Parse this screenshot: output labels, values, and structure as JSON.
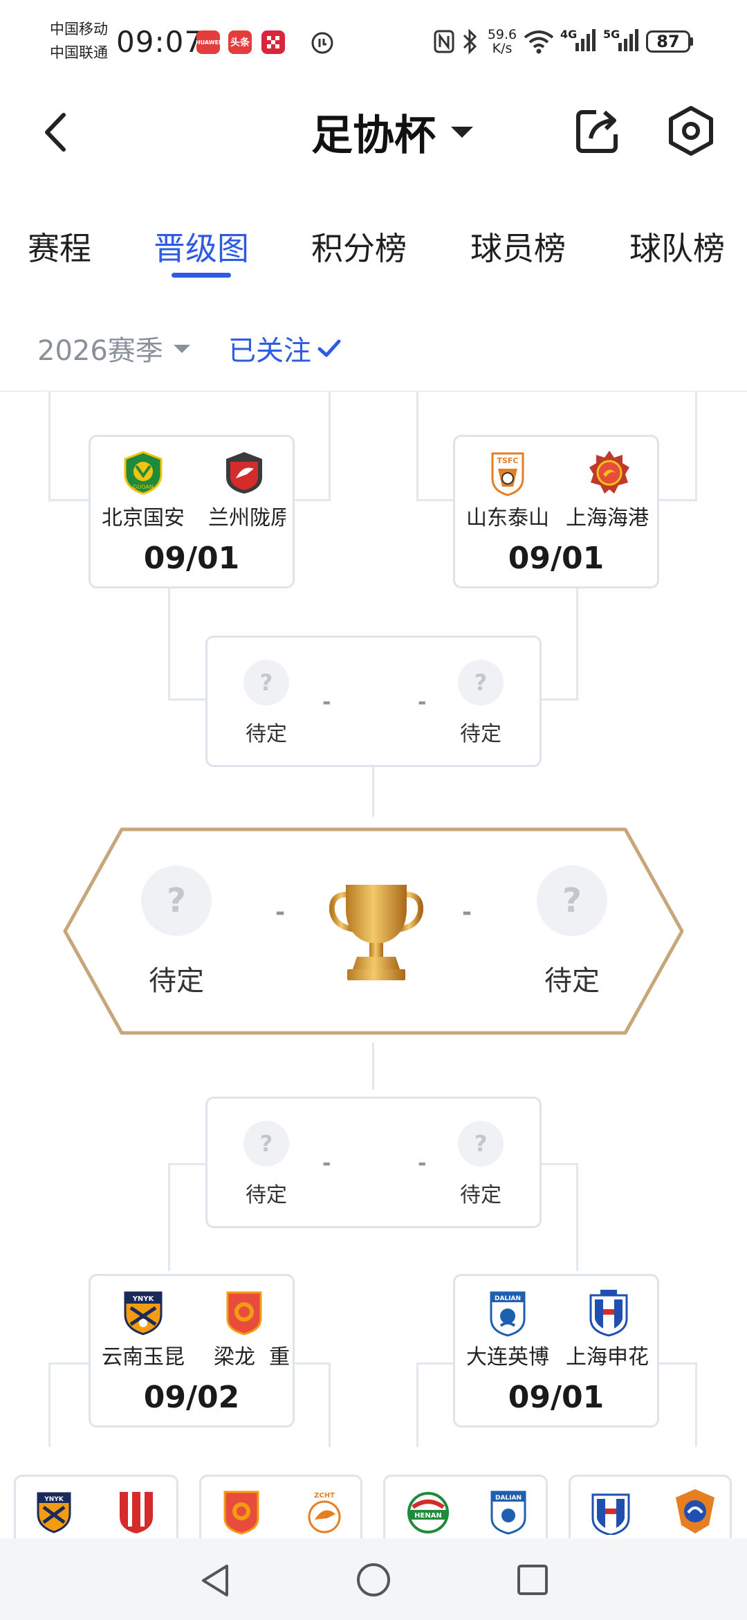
{
  "status_bar": {
    "carrier1": "中国移动",
    "carrier2": "中国联通",
    "time": "09:07",
    "app_badges": [
      "HUAWEI",
      "头条"
    ],
    "net_speed_value": "59.6",
    "net_speed_unit": "K/s",
    "signal1": "4G",
    "signal2": "5G",
    "battery": "87"
  },
  "header": {
    "title": "足协杯",
    "icons": [
      "back-arrow-icon",
      "dropdown-caret-icon",
      "share-icon",
      "settings-icon"
    ]
  },
  "tabs": [
    {
      "label": "赛程",
      "active": false
    },
    {
      "label": "晋级图",
      "active": true
    },
    {
      "label": "积分榜",
      "active": false
    },
    {
      "label": "球员榜",
      "active": false
    },
    {
      "label": "球队榜",
      "active": false
    }
  ],
  "filter": {
    "season": "2026赛季",
    "follow": "已关注"
  },
  "bracket": {
    "top_left": {
      "home": "北京国安",
      "away": "兰州陇原",
      "date": "09/01"
    },
    "top_right": {
      "home": "山东泰山",
      "away": "上海海港",
      "date": "09/01"
    },
    "semi_top": {
      "home": "待定",
      "away": "待定",
      "dash": "-"
    },
    "final": {
      "home": "待定",
      "away": "待定",
      "dash": "-"
    },
    "semi_bottom": {
      "home": "待定",
      "away": "待定",
      "dash": "-"
    },
    "bottom_left": {
      "home": "云南玉昆",
      "away": "梁龙",
      "away2": "重",
      "date": "09/02"
    },
    "bottom_right": {
      "home": "大连英博",
      "away": "上海申花",
      "date": "09/01"
    },
    "crest_texts": {
      "tsfc": "TSFC",
      "ynyk": "YNYK",
      "dalian": "DALIAN",
      "henan": "HENAN",
      "zcht": "ZCHT",
      "guoan": "GUOAN"
    }
  },
  "colors": {
    "accent": "#2d5be3",
    "final_border": "#c9a67a",
    "trophy_gold": "#d9a441"
  }
}
